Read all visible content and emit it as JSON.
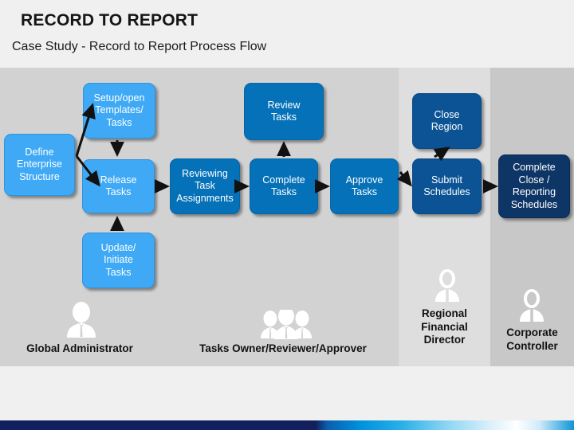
{
  "header": {
    "title": "RECORD TO REPORT",
    "subtitle": "Case Study - Record to Report Process Flow"
  },
  "colors": {
    "light_blue": "#3fa9f5",
    "mid_blue": "#0571b8",
    "deep_blue": "#0b5394",
    "navy": "#0d3566",
    "lane_1": "#d2d2d2",
    "lane_2": "#dedede",
    "lane_3": "#c8c8c8",
    "page_bg": "#f0f0f0"
  },
  "diagram": {
    "type": "process-flow",
    "nodes": [
      {
        "id": "define-enterprise-structure",
        "label": "Define\nEnterprise\nStructure",
        "line1": "Define",
        "line2": "Enterprise",
        "line3": "Structure",
        "lane": "Global Administrator",
        "color": "light_blue"
      },
      {
        "id": "setup-open-templates-tasks",
        "label": "Setup/open\nTemplates/\nTasks",
        "line1": "Setup/open",
        "line2": "Templates/",
        "line3": "Tasks",
        "lane": "Global Administrator",
        "color": "light_blue"
      },
      {
        "id": "release-tasks",
        "label": "Release\nTasks",
        "line1": "Release",
        "line2": "Tasks",
        "lane": "Global Administrator",
        "color": "light_blue"
      },
      {
        "id": "update-initiate-tasks",
        "label": "Update/\nInitiate\nTasks",
        "line1": "Update/",
        "line2": "Initiate",
        "line3": "Tasks",
        "lane": "Global Administrator",
        "color": "light_blue"
      },
      {
        "id": "reviewing-task-assignments",
        "label": "Reviewing\nTask\nAssignments",
        "line1": "Reviewing",
        "line2": "Task",
        "line3": "Assignments",
        "lane": "Tasks Owner/Reviewer/Approver",
        "color": "mid_blue"
      },
      {
        "id": "review-tasks",
        "label": "Review\nTasks",
        "line1": "Review",
        "line2": "Tasks",
        "lane": "Tasks Owner/Reviewer/Approver",
        "color": "mid_blue"
      },
      {
        "id": "complete-tasks",
        "label": "Complete\nTasks",
        "line1": "Complete",
        "line2": "Tasks",
        "lane": "Tasks Owner/Reviewer/Approver",
        "color": "mid_blue"
      },
      {
        "id": "approve-tasks",
        "label": "Approve\nTasks",
        "line1": "Approve",
        "line2": "Tasks",
        "lane": "Tasks Owner/Reviewer/Approver",
        "color": "mid_blue"
      },
      {
        "id": "close-region",
        "label": "Close\nRegion",
        "line1": "Close",
        "line2": "Region",
        "lane": "Regional Financial Director",
        "color": "deep_blue"
      },
      {
        "id": "submit-schedules",
        "label": "Submit\nSchedules",
        "line1": "Submit",
        "line2": "Schedules",
        "lane": "Regional Financial Director",
        "color": "deep_blue"
      },
      {
        "id": "complete-close-reporting-schedules",
        "label": "Complete\nClose /\nReporting\nSchedules",
        "line1": "Complete",
        "line2": "Close /",
        "line3": "Reporting",
        "line4": "Schedules",
        "lane": "Corporate Controller",
        "color": "navy"
      }
    ],
    "edges": [
      {
        "from": "define-enterprise-structure",
        "to": "setup-open-templates-tasks"
      },
      {
        "from": "define-enterprise-structure",
        "to": "release-tasks"
      },
      {
        "from": "setup-open-templates-tasks",
        "to": "release-tasks"
      },
      {
        "from": "update-initiate-tasks",
        "to": "release-tasks"
      },
      {
        "from": "release-tasks",
        "to": "reviewing-task-assignments"
      },
      {
        "from": "reviewing-task-assignments",
        "to": "complete-tasks"
      },
      {
        "from": "complete-tasks",
        "to": "review-tasks"
      },
      {
        "from": "complete-tasks",
        "to": "approve-tasks"
      },
      {
        "from": "approve-tasks",
        "to": "submit-schedules"
      },
      {
        "from": "submit-schedules",
        "to": "close-region"
      },
      {
        "from": "submit-schedules",
        "to": "complete-close-reporting-schedules"
      }
    ],
    "lanes": [
      {
        "id": "global-administrator",
        "label": "Global Administrator",
        "icon": "single-person-icon"
      },
      {
        "id": "tasks-owner-reviewer-approver",
        "label": "Tasks Owner/Reviewer/Approver",
        "icon": "three-people-icon"
      },
      {
        "id": "regional-financial-director",
        "label_line1": "Regional",
        "label_line2": "Financial",
        "label_line3": "Director",
        "label": "Regional Financial Director",
        "icon": "two-people-icon"
      },
      {
        "id": "corporate-controller",
        "label_line1": "Corporate",
        "label_line2": "Controller",
        "label": "Corporate Controller",
        "icon": "two-people-icon"
      }
    ]
  }
}
